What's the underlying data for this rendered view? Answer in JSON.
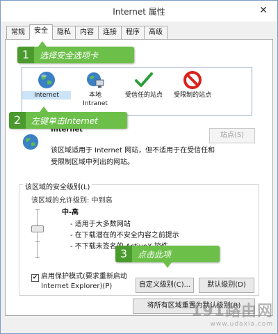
{
  "window": {
    "title": "Internet 属性",
    "close_symbol": "✕"
  },
  "tabs": [
    {
      "label": "常规"
    },
    {
      "label": "安全"
    },
    {
      "label": "隐私"
    },
    {
      "label": "内容"
    },
    {
      "label": "连接"
    },
    {
      "label": "程序"
    },
    {
      "label": "高级"
    }
  ],
  "zones": [
    {
      "label": "Internet",
      "icon": "globe-icon"
    },
    {
      "label": "本地\nIntranet",
      "icon": "intranet-icon"
    },
    {
      "label": "受信任的站点",
      "icon": "checkmark-icon"
    },
    {
      "label": "受限制的站点",
      "icon": "restricted-icon"
    }
  ],
  "zone_info": {
    "title": "Internet",
    "description": "该区域适用于 Internet 网站，但不适用于在受信任和受限制区域中列出的网站。",
    "sites_button": "站点(S)"
  },
  "security_level": {
    "group_title": "该区域的安全级别(L)",
    "allowed_label": "该区域的允许级别: 中到高",
    "level_name": "中-高",
    "level_points": [
      "- 适用于大多数网站",
      "- 在下载潜在的不安全内容之前提示",
      "- 不下载未签名的 ActiveX 控件"
    ],
    "level_fraction": 0.6
  },
  "protected_mode": {
    "checked": true,
    "check_symbol": "✔",
    "line1": "启用保护模式(要求重新启动",
    "line2": "Internet Explorer)(P)"
  },
  "buttons": {
    "custom_level": "自定义级别(C)...",
    "default_level": "默认级别(D)",
    "reset_all": "将所有区域重置为默认级别(R)"
  },
  "callouts": [
    {
      "number": "1",
      "text": "选择安全选项卡"
    },
    {
      "number": "2",
      "text": "左键单击Internet"
    },
    {
      "number": "3",
      "text": "点击此项"
    }
  ],
  "watermark": {
    "big": "191路由网",
    "small": "www.udaxia.com"
  },
  "colors": {
    "callout_green": "#6cc04a",
    "callout_green_dark": "#4a9a2e",
    "selection_blue": "#cce4f7"
  }
}
